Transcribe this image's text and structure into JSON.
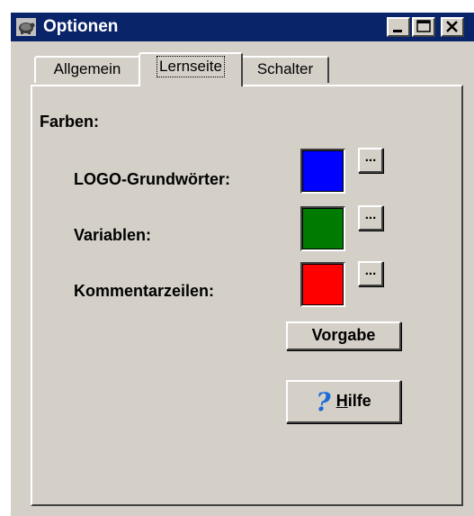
{
  "window": {
    "title": "Optionen",
    "icon": "turtle-icon",
    "controls": [
      "minimize-icon",
      "maximize-icon",
      "close-icon"
    ]
  },
  "tabs": [
    {
      "label": "Allgemein",
      "active": false
    },
    {
      "label": "Lernseite",
      "active": true
    },
    {
      "label": "Schalter",
      "active": false
    }
  ],
  "panel": {
    "section_label": "Farben:",
    "rows": [
      {
        "label": "LOGO-Grundwörter:",
        "color": "#0000ff",
        "button": "..."
      },
      {
        "label": "Variablen:",
        "color": "#007a00",
        "button": "..."
      },
      {
        "label": "Kommentarzeilen:",
        "color": "#ff0000",
        "button": "..."
      }
    ],
    "default_button": "Vorgabe",
    "help_button": {
      "prefix": "H",
      "rest": "ilfe",
      "icon": "help-question-icon"
    }
  },
  "colors": {
    "titlebar": "#0a246a",
    "face": "#d4d0c8"
  }
}
